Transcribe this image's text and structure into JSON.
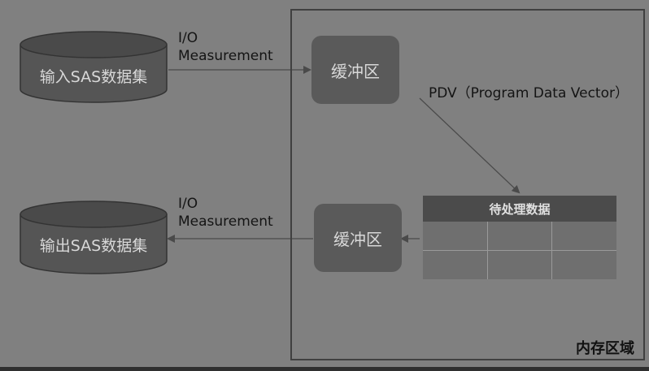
{
  "input_db": {
    "label": "输入SAS数据集"
  },
  "output_db": {
    "label": "输出SAS数据集"
  },
  "io_top": {
    "line1": "I/O",
    "line2": "Measurement"
  },
  "io_bottom": {
    "line1": "I/O",
    "line2": "Measurement"
  },
  "buffer_top": {
    "label": "缓冲区"
  },
  "buffer_bottom": {
    "label": "缓冲区"
  },
  "pdv": {
    "label": "PDV（Program Data Vector）"
  },
  "pending_table": {
    "header": "待处理数据",
    "rows": 2,
    "cols": 3
  },
  "memory_region": {
    "label": "内存区域"
  },
  "colors": {
    "background": "#808080",
    "cylinder_fill": "#555555",
    "buffer_fill": "#5a5a5a",
    "arrow": "#4a4a4a"
  }
}
